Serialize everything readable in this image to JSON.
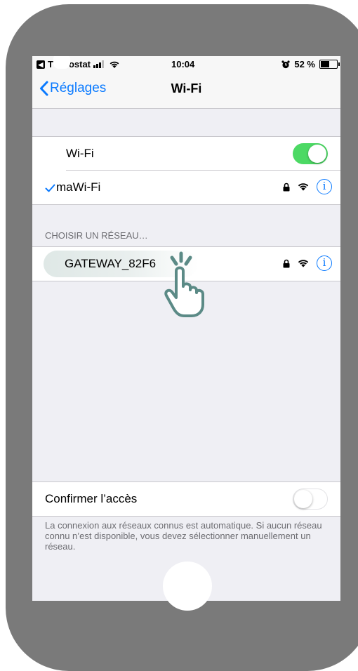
{
  "status_bar": {
    "carrier_start": "T",
    "carrier_end": "ostat",
    "time": "10:04",
    "battery": "52 %",
    "badge_icon": "back-to-app-icon",
    "signal_icon": "cellular-signal-icon",
    "wifi_icon": "wifi-icon",
    "alarm_icon": "alarm-icon",
    "battery_icon": "battery-icon"
  },
  "nav": {
    "back_label": "Réglages",
    "title": "Wi-Fi"
  },
  "wifi_toggle": {
    "label": "Wi-Fi",
    "state": "on"
  },
  "connected_network": {
    "name": "maWi-Fi",
    "secured": true
  },
  "networks_section": {
    "header": "CHOISIR UN RÉSEAU…",
    "networks": [
      {
        "name": "GATEWAY_82F6",
        "secured": true
      }
    ]
  },
  "confirm_access": {
    "label": "Confirmer l’accès",
    "state": "off",
    "footer": "La connexion aux réseaux connus est automatique. Si aucun réseau connu n’est disponible, vous devez sélectionner manuellement un réseau."
  },
  "info_glyph": "i",
  "colors": {
    "accent": "#0a7aff",
    "toggle_on": "#4cd964",
    "frame": "#7a7a7a",
    "hand": "#5b8a86"
  },
  "annotation": {
    "icon": "tap-hand-icon"
  }
}
